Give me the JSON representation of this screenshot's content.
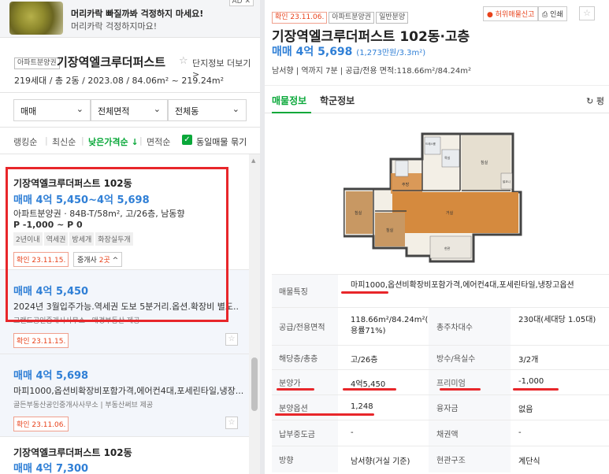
{
  "ad": {
    "title": "머리카락 빠질까봐 걱정하지 마세요!",
    "subtitle": "머리카락 걱정하지마요!",
    "badge": "AD ✕"
  },
  "complex": {
    "tag": "아파트분양권",
    "name": "기장역엘크루더퍼스트",
    "more": "단지정보 더보기",
    "info": "219세대 / 총 2동 / 2023.08 / 84.06m² ~ 219.24m²"
  },
  "filters": {
    "deal": "매매",
    "area": "전체면적",
    "building": "전체동"
  },
  "sorts": [
    "랭킹순",
    "최신순",
    "낮은가격순",
    "면적순"
  ],
  "sort_active_arrow": "↓",
  "same_listing_label": "동일매물 묶기",
  "listings": [
    {
      "name": "기장역엘크루더퍼스트 102동",
      "price": "매매 4억 5,450~4억 5,698",
      "spec": "아파트분양권 · 84B-T/58m², 고/26층, 남동향",
      "premium": "P -1,000 ~ P 0",
      "chips": [
        "2년이내",
        "역세권",
        "방세개",
        "화장실두개"
      ],
      "confirm": "확인 23.11.15.",
      "broker_label": "중개사",
      "broker_count": "2곳",
      "broker_chevron": "^"
    },
    {
      "price": "매매 4억 5,450",
      "desc": "2024년 3월입주가능.역세권 도보 5분거리.옵션.확장비 별도..",
      "agency": "그랜드공인중개사사무소 · 매경부동산 제공",
      "confirm": "확인 23.11.15."
    },
    {
      "price": "매매 4억 5,698",
      "desc": "마피1000,옵션비확장비포함가격,에어컨4대,포세린타일,냉장...",
      "agency": "골든부동산공인중개사사무소 | 부동산써브 제공",
      "confirm": "확인 23.11.06."
    },
    {
      "name": "기장역엘크루더퍼스트 102동",
      "price": "매매 4억 7,300"
    }
  ],
  "detail": {
    "tags": [
      "확인 23.11.06.",
      "아파트분양권",
      "일반분양"
    ],
    "report": "허위매물신고",
    "print": "인쇄",
    "title": "기장역엘크루더퍼스트 102동·고층",
    "price_main": "매매 4억 5,698",
    "price_unit": "(1,273만원/3.3m²)",
    "meta": "남서향 | 역까지 7분 | 공급/전용 면적:118.66m²/84.24m²",
    "tabs": [
      "매물정보",
      "학군정보"
    ],
    "refresh": "평"
  },
  "floorplan_rooms": [
    "침실",
    "침실",
    "침실",
    "욕실",
    "드레스룸",
    "거실",
    "주방",
    "발코니",
    "현관"
  ],
  "table": [
    {
      "label": "매물특징",
      "value": "마피1000,옵션비확장비포함가격,에어컨4대,포세린타일,냉장고옵션"
    },
    {
      "label": "공급/전용면적",
      "value": "118.66m²/84.24m²(전용률71%)",
      "label2": "총주차대수",
      "value2": "230대(세대당 1.05대)"
    },
    {
      "label": "해당층/총층",
      "value": "고/26층",
      "label2": "방수/욕실수",
      "value2": "3/2개"
    },
    {
      "label": "분양가",
      "value": "4억5,450",
      "label2": "프리미엄",
      "value2": "-1,000"
    },
    {
      "label": "분양옵션",
      "value": "1,248",
      "label2": "융자금",
      "value2": "없음"
    },
    {
      "label": "납부중도금",
      "value": "-",
      "label2": "채권액",
      "value2": "-"
    },
    {
      "label": "방향",
      "value": "남서향(거실 기준)",
      "label2": "현관구조",
      "value2": "계단식"
    }
  ]
}
